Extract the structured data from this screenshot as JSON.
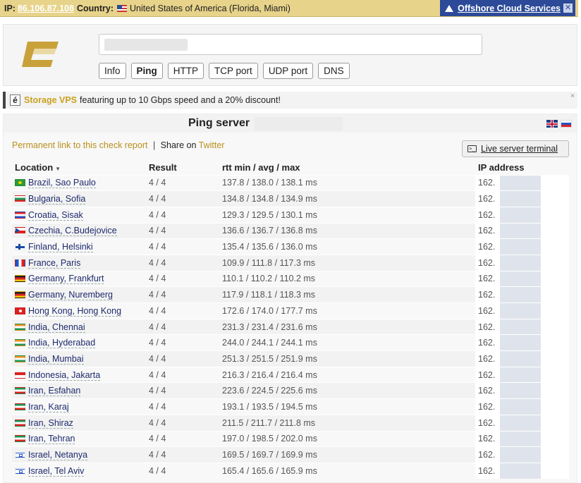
{
  "topbar": {
    "ip_label": "IP:",
    "ip_value": "86.106.87.108",
    "country_label": "Country:",
    "country_value": "United States of America (Florida, Miami)",
    "offshore_text": "Offshore Cloud Services",
    "close_glyph": "✕"
  },
  "search": {
    "input_value": "",
    "tabs": [
      {
        "label": "Info",
        "active": false
      },
      {
        "label": "Ping",
        "active": true
      },
      {
        "label": "HTTP",
        "active": false
      },
      {
        "label": "TCP port",
        "active": false
      },
      {
        "label": "UDP port",
        "active": false
      },
      {
        "label": "DNS",
        "active": false
      }
    ]
  },
  "ad": {
    "icon_letter": "é",
    "brand": "Storage VPS",
    "text": "featuring up to 10 Gbps speed and a 20% discount!",
    "close_glyph": "×"
  },
  "results": {
    "title": "Ping server",
    "permalink": "Permanent link to this check report",
    "separator": "|",
    "share_prefix": "Share on",
    "share_target": "Twitter",
    "terminal_label": "Live server terminal",
    "terminal_icon": ">_",
    "headers": {
      "location": "Location",
      "sort_glyph": "▼",
      "result": "Result",
      "rtt": "rtt min / avg / max",
      "ip": "IP address"
    },
    "rows": [
      {
        "flag": "br",
        "location": "Brazil, Sao Paulo",
        "result": "4 / 4",
        "rtt": "137.8 / 138.0 / 138.1 ms",
        "ip": "162."
      },
      {
        "flag": "bg",
        "location": "Bulgaria, Sofia",
        "result": "4 / 4",
        "rtt": "134.8 / 134.8 / 134.9 ms",
        "ip": "162."
      },
      {
        "flag": "hr",
        "location": "Croatia, Sisak",
        "result": "4 / 4",
        "rtt": "129.3 / 129.5 / 130.1 ms",
        "ip": "162."
      },
      {
        "flag": "cz",
        "location": "Czechia, C.Budejovice",
        "result": "4 / 4",
        "rtt": "136.6 / 136.7 / 136.8 ms",
        "ip": "162."
      },
      {
        "flag": "fi",
        "location": "Finland, Helsinki",
        "result": "4 / 4",
        "rtt": "135.4 / 135.6 / 136.0 ms",
        "ip": "162."
      },
      {
        "flag": "fr",
        "location": "France, Paris",
        "result": "4 / 4",
        "rtt": "109.9 / 111.8 / 117.3 ms",
        "ip": "162."
      },
      {
        "flag": "de",
        "location": "Germany, Frankfurt",
        "result": "4 / 4",
        "rtt": "110.1 / 110.2 / 110.2 ms",
        "ip": "162."
      },
      {
        "flag": "de",
        "location": "Germany, Nuremberg",
        "result": "4 / 4",
        "rtt": "117.9 / 118.1 / 118.3 ms",
        "ip": "162."
      },
      {
        "flag": "hk",
        "location": "Hong Kong, Hong Kong",
        "result": "4 / 4",
        "rtt": "172.6 / 174.0 / 177.7 ms",
        "ip": "162."
      },
      {
        "flag": "in",
        "location": "India, Chennai",
        "result": "4 / 4",
        "rtt": "231.3 / 231.4 / 231.6 ms",
        "ip": "162."
      },
      {
        "flag": "in",
        "location": "India, Hyderabad",
        "result": "4 / 4",
        "rtt": "244.0 / 244.1 / 244.1 ms",
        "ip": "162."
      },
      {
        "flag": "in",
        "location": "India, Mumbai",
        "result": "4 / 4",
        "rtt": "251.3 / 251.5 / 251.9 ms",
        "ip": "162."
      },
      {
        "flag": "id",
        "location": "Indonesia, Jakarta",
        "result": "4 / 4",
        "rtt": "216.3 / 216.4 / 216.4 ms",
        "ip": "162."
      },
      {
        "flag": "ir",
        "location": "Iran, Esfahan",
        "result": "4 / 4",
        "rtt": "223.6 / 224.5 / 225.6 ms",
        "ip": "162."
      },
      {
        "flag": "ir",
        "location": "Iran, Karaj",
        "result": "4 / 4",
        "rtt": "193.1 / 193.5 / 194.5 ms",
        "ip": "162."
      },
      {
        "flag": "ir",
        "location": "Iran, Shiraz",
        "result": "4 / 4",
        "rtt": "211.5 / 211.7 / 211.8 ms",
        "ip": "162."
      },
      {
        "flag": "ir",
        "location": "Iran, Tehran",
        "result": "4 / 4",
        "rtt": "197.0 / 198.5 / 202.0 ms",
        "ip": "162."
      },
      {
        "flag": "il",
        "location": "Israel, Netanya",
        "result": "4 / 4",
        "rtt": "169.5 / 169.7 / 169.9 ms",
        "ip": "162."
      },
      {
        "flag": "il",
        "location": "Israel, Tel Aviv",
        "result": "4 / 4",
        "rtt": "165.4 / 165.6 / 165.9 ms",
        "ip": "162."
      }
    ]
  },
  "colors": {
    "topbar_bg": "#e7d38a",
    "offshore_bg": "#2c4a98",
    "brand_gold": "#c9a13a",
    "link_gold": "#b8901a"
  }
}
